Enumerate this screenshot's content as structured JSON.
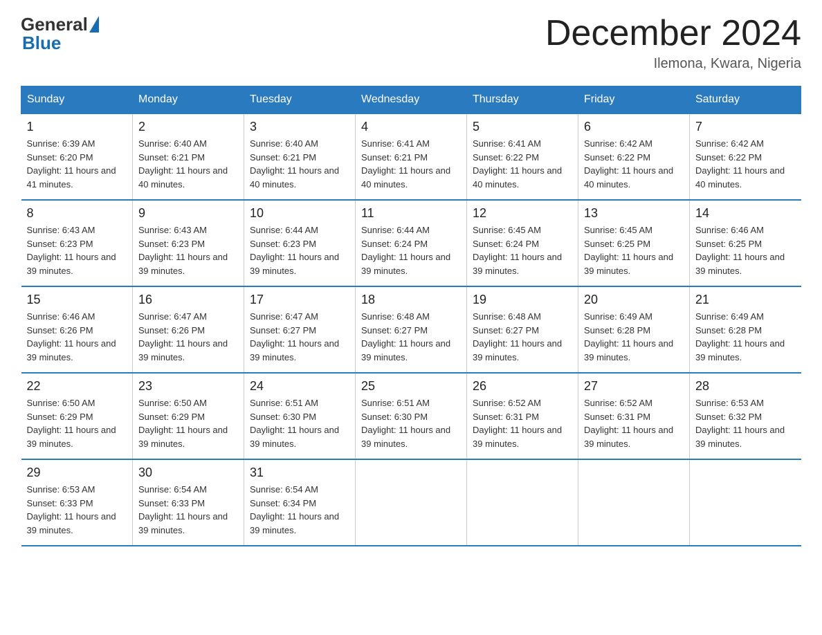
{
  "header": {
    "logo_general": "General",
    "logo_blue": "Blue",
    "month_title": "December 2024",
    "location": "Ilemona, Kwara, Nigeria"
  },
  "days_of_week": [
    "Sunday",
    "Monday",
    "Tuesday",
    "Wednesday",
    "Thursday",
    "Friday",
    "Saturday"
  ],
  "weeks": [
    [
      {
        "day": "1",
        "sunrise": "Sunrise: 6:39 AM",
        "sunset": "Sunset: 6:20 PM",
        "daylight": "Daylight: 11 hours and 41 minutes."
      },
      {
        "day": "2",
        "sunrise": "Sunrise: 6:40 AM",
        "sunset": "Sunset: 6:21 PM",
        "daylight": "Daylight: 11 hours and 40 minutes."
      },
      {
        "day": "3",
        "sunrise": "Sunrise: 6:40 AM",
        "sunset": "Sunset: 6:21 PM",
        "daylight": "Daylight: 11 hours and 40 minutes."
      },
      {
        "day": "4",
        "sunrise": "Sunrise: 6:41 AM",
        "sunset": "Sunset: 6:21 PM",
        "daylight": "Daylight: 11 hours and 40 minutes."
      },
      {
        "day": "5",
        "sunrise": "Sunrise: 6:41 AM",
        "sunset": "Sunset: 6:22 PM",
        "daylight": "Daylight: 11 hours and 40 minutes."
      },
      {
        "day": "6",
        "sunrise": "Sunrise: 6:42 AM",
        "sunset": "Sunset: 6:22 PM",
        "daylight": "Daylight: 11 hours and 40 minutes."
      },
      {
        "day": "7",
        "sunrise": "Sunrise: 6:42 AM",
        "sunset": "Sunset: 6:22 PM",
        "daylight": "Daylight: 11 hours and 40 minutes."
      }
    ],
    [
      {
        "day": "8",
        "sunrise": "Sunrise: 6:43 AM",
        "sunset": "Sunset: 6:23 PM",
        "daylight": "Daylight: 11 hours and 39 minutes."
      },
      {
        "day": "9",
        "sunrise": "Sunrise: 6:43 AM",
        "sunset": "Sunset: 6:23 PM",
        "daylight": "Daylight: 11 hours and 39 minutes."
      },
      {
        "day": "10",
        "sunrise": "Sunrise: 6:44 AM",
        "sunset": "Sunset: 6:23 PM",
        "daylight": "Daylight: 11 hours and 39 minutes."
      },
      {
        "day": "11",
        "sunrise": "Sunrise: 6:44 AM",
        "sunset": "Sunset: 6:24 PM",
        "daylight": "Daylight: 11 hours and 39 minutes."
      },
      {
        "day": "12",
        "sunrise": "Sunrise: 6:45 AM",
        "sunset": "Sunset: 6:24 PM",
        "daylight": "Daylight: 11 hours and 39 minutes."
      },
      {
        "day": "13",
        "sunrise": "Sunrise: 6:45 AM",
        "sunset": "Sunset: 6:25 PM",
        "daylight": "Daylight: 11 hours and 39 minutes."
      },
      {
        "day": "14",
        "sunrise": "Sunrise: 6:46 AM",
        "sunset": "Sunset: 6:25 PM",
        "daylight": "Daylight: 11 hours and 39 minutes."
      }
    ],
    [
      {
        "day": "15",
        "sunrise": "Sunrise: 6:46 AM",
        "sunset": "Sunset: 6:26 PM",
        "daylight": "Daylight: 11 hours and 39 minutes."
      },
      {
        "day": "16",
        "sunrise": "Sunrise: 6:47 AM",
        "sunset": "Sunset: 6:26 PM",
        "daylight": "Daylight: 11 hours and 39 minutes."
      },
      {
        "day": "17",
        "sunrise": "Sunrise: 6:47 AM",
        "sunset": "Sunset: 6:27 PM",
        "daylight": "Daylight: 11 hours and 39 minutes."
      },
      {
        "day": "18",
        "sunrise": "Sunrise: 6:48 AM",
        "sunset": "Sunset: 6:27 PM",
        "daylight": "Daylight: 11 hours and 39 minutes."
      },
      {
        "day": "19",
        "sunrise": "Sunrise: 6:48 AM",
        "sunset": "Sunset: 6:27 PM",
        "daylight": "Daylight: 11 hours and 39 minutes."
      },
      {
        "day": "20",
        "sunrise": "Sunrise: 6:49 AM",
        "sunset": "Sunset: 6:28 PM",
        "daylight": "Daylight: 11 hours and 39 minutes."
      },
      {
        "day": "21",
        "sunrise": "Sunrise: 6:49 AM",
        "sunset": "Sunset: 6:28 PM",
        "daylight": "Daylight: 11 hours and 39 minutes."
      }
    ],
    [
      {
        "day": "22",
        "sunrise": "Sunrise: 6:50 AM",
        "sunset": "Sunset: 6:29 PM",
        "daylight": "Daylight: 11 hours and 39 minutes."
      },
      {
        "day": "23",
        "sunrise": "Sunrise: 6:50 AM",
        "sunset": "Sunset: 6:29 PM",
        "daylight": "Daylight: 11 hours and 39 minutes."
      },
      {
        "day": "24",
        "sunrise": "Sunrise: 6:51 AM",
        "sunset": "Sunset: 6:30 PM",
        "daylight": "Daylight: 11 hours and 39 minutes."
      },
      {
        "day": "25",
        "sunrise": "Sunrise: 6:51 AM",
        "sunset": "Sunset: 6:30 PM",
        "daylight": "Daylight: 11 hours and 39 minutes."
      },
      {
        "day": "26",
        "sunrise": "Sunrise: 6:52 AM",
        "sunset": "Sunset: 6:31 PM",
        "daylight": "Daylight: 11 hours and 39 minutes."
      },
      {
        "day": "27",
        "sunrise": "Sunrise: 6:52 AM",
        "sunset": "Sunset: 6:31 PM",
        "daylight": "Daylight: 11 hours and 39 minutes."
      },
      {
        "day": "28",
        "sunrise": "Sunrise: 6:53 AM",
        "sunset": "Sunset: 6:32 PM",
        "daylight": "Daylight: 11 hours and 39 minutes."
      }
    ],
    [
      {
        "day": "29",
        "sunrise": "Sunrise: 6:53 AM",
        "sunset": "Sunset: 6:33 PM",
        "daylight": "Daylight: 11 hours and 39 minutes."
      },
      {
        "day": "30",
        "sunrise": "Sunrise: 6:54 AM",
        "sunset": "Sunset: 6:33 PM",
        "daylight": "Daylight: 11 hours and 39 minutes."
      },
      {
        "day": "31",
        "sunrise": "Sunrise: 6:54 AM",
        "sunset": "Sunset: 6:34 PM",
        "daylight": "Daylight: 11 hours and 39 minutes."
      },
      {
        "day": "",
        "sunrise": "",
        "sunset": "",
        "daylight": ""
      },
      {
        "day": "",
        "sunrise": "",
        "sunset": "",
        "daylight": ""
      },
      {
        "day": "",
        "sunrise": "",
        "sunset": "",
        "daylight": ""
      },
      {
        "day": "",
        "sunrise": "",
        "sunset": "",
        "daylight": ""
      }
    ]
  ]
}
